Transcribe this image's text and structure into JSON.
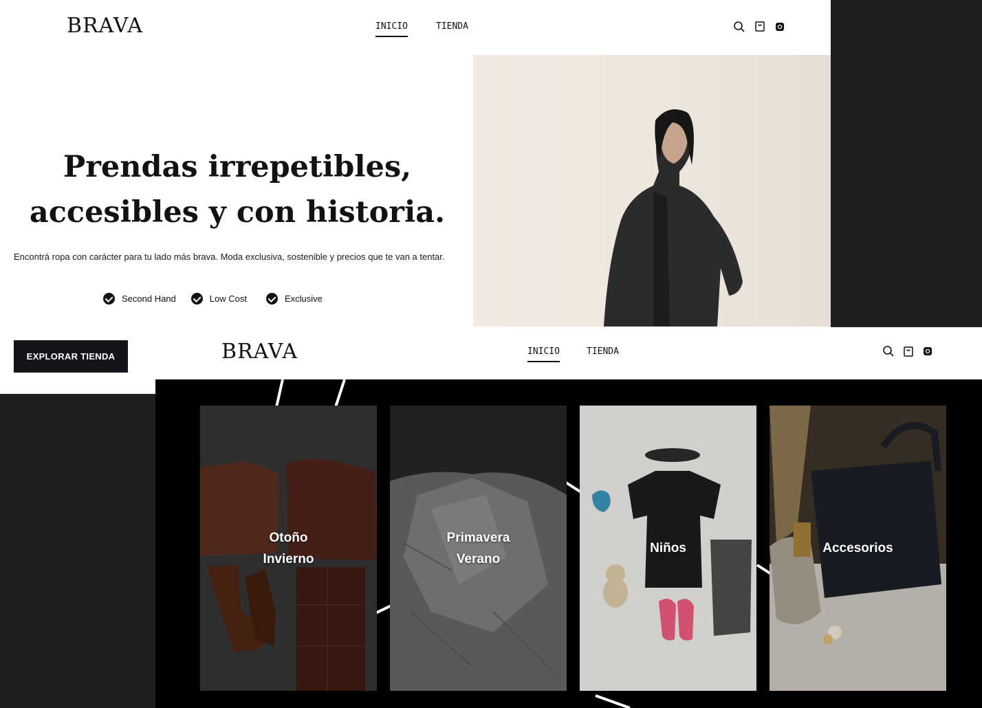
{
  "brand": "BRAVA",
  "nav": {
    "items": [
      "INICIO",
      "TIENDA"
    ],
    "active": "INICIO"
  },
  "hero": {
    "headline_line1": "Prendas irrepetibles,",
    "headline_line2": "accesibles y con historia.",
    "subtitle": "Encontrá ropa con carácter para tu lado más brava. Moda exclusiva, sostenible y precios que te van a tentar.",
    "features": [
      "Second Hand",
      "Low Cost",
      "Exclusive"
    ],
    "cta": "EXPLORAR TIENDA"
  },
  "categories": [
    {
      "line1": "Otoño",
      "line2": "Invierno"
    },
    {
      "line1": "Primavera",
      "line2": "Verano"
    },
    {
      "line1": "Niños",
      "line2": ""
    },
    {
      "line1": "Accesorios",
      "line2": ""
    }
  ],
  "icons": [
    "search-icon",
    "cart-icon",
    "instagram-icon"
  ],
  "colors": {
    "dark": "#17131a",
    "page_bg": "#1f1f1f",
    "white": "#ffffff"
  }
}
